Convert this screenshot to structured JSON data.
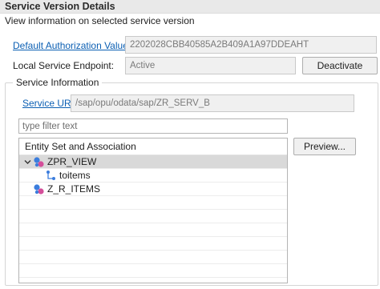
{
  "header": {
    "title": "Service Version Details",
    "description": "View information on selected service version"
  },
  "authorization": {
    "label": "Default Authorization Values:",
    "value": "2202028CBB40585A2B409A1A97DDEAHT"
  },
  "endpoint": {
    "label": "Local Service Endpoint:",
    "status": "Active",
    "button_label": "Deactivate"
  },
  "service_info": {
    "group_title": "Service Information",
    "url_label": "Service URL:",
    "url_value": "/sap/opu/odata/sap/ZR_SERV_B",
    "filter_placeholder": "type filter text",
    "tree_header": "Entity Set and Association",
    "preview_button": "Preview...",
    "nodes": [
      {
        "label": "ZPR_VIEW",
        "expanded": true,
        "selected": true,
        "icon": "entity-set-icon"
      },
      {
        "label": "toitems",
        "child": true,
        "icon": "association-icon"
      },
      {
        "label": "Z_R_ITEMS",
        "expanded": false,
        "icon": "entity-set-icon"
      }
    ]
  },
  "colors": {
    "link": "#0b5fb3",
    "selection": "#d9d9d9",
    "icon_blue": "#3b7ddd",
    "icon_pink": "#d44f9a"
  }
}
